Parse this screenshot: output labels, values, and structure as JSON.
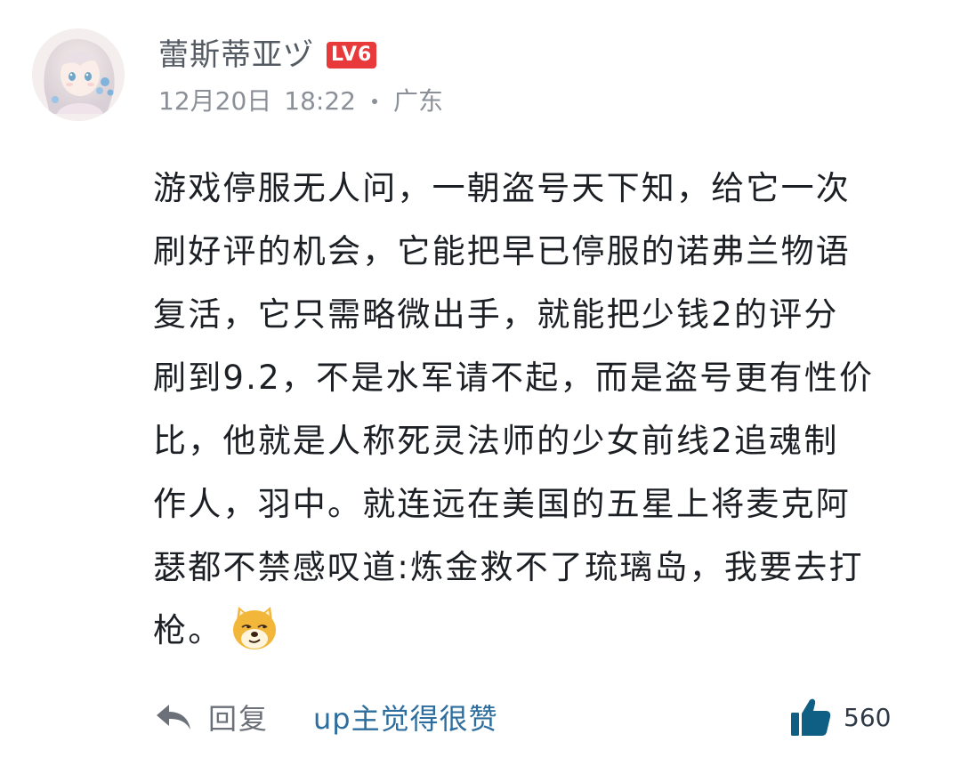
{
  "comment": {
    "username": "蕾斯蒂亚ヅ",
    "level": "LV6",
    "date": "12月20日",
    "time": "18:22",
    "location": "广东",
    "text": "游戏停服无人问，一朝盗号天下知，给它一次\n刷好评的机会，它能把早已停服的诺弗兰物语\n复活，它只需略微出手，就能把少钱2的评分\n刷到9.2，不是水军请不起，而是盗号更有性价\n比，他就是人称死灵法师的少女前线2追魂制\n作人，羽中。就连远在美国的五星上将麦克阿\n瑟都不禁感叹道:炼金救不了琉璃岛，我要去打\n枪。",
    "emoji": "doge-emoji",
    "reply_label": "回复",
    "up_liked_label": "up主觉得很赞",
    "like_count": "560"
  },
  "colors": {
    "level_badge": "#e8393b",
    "up_liked": "#2d6e9e",
    "like_icon": "#0f5f85"
  },
  "icons": {
    "reply": "reply-arrow-icon",
    "like": "thumbs-up-icon"
  }
}
